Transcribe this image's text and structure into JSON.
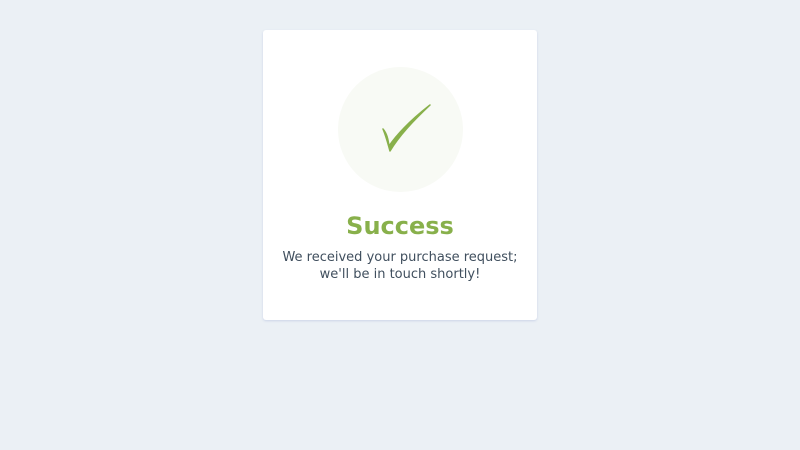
{
  "card": {
    "icon": "check-mark-icon",
    "title": "Success",
    "message_lines": [
      "We received your purchase request;",
      "we'll be in touch shortly!"
    ]
  },
  "colors": {
    "background": "#ebf0f5",
    "card": "#ffffff",
    "accent": "#88b04b",
    "icon_circle": "#f8faf5",
    "text": "#404f5e"
  }
}
